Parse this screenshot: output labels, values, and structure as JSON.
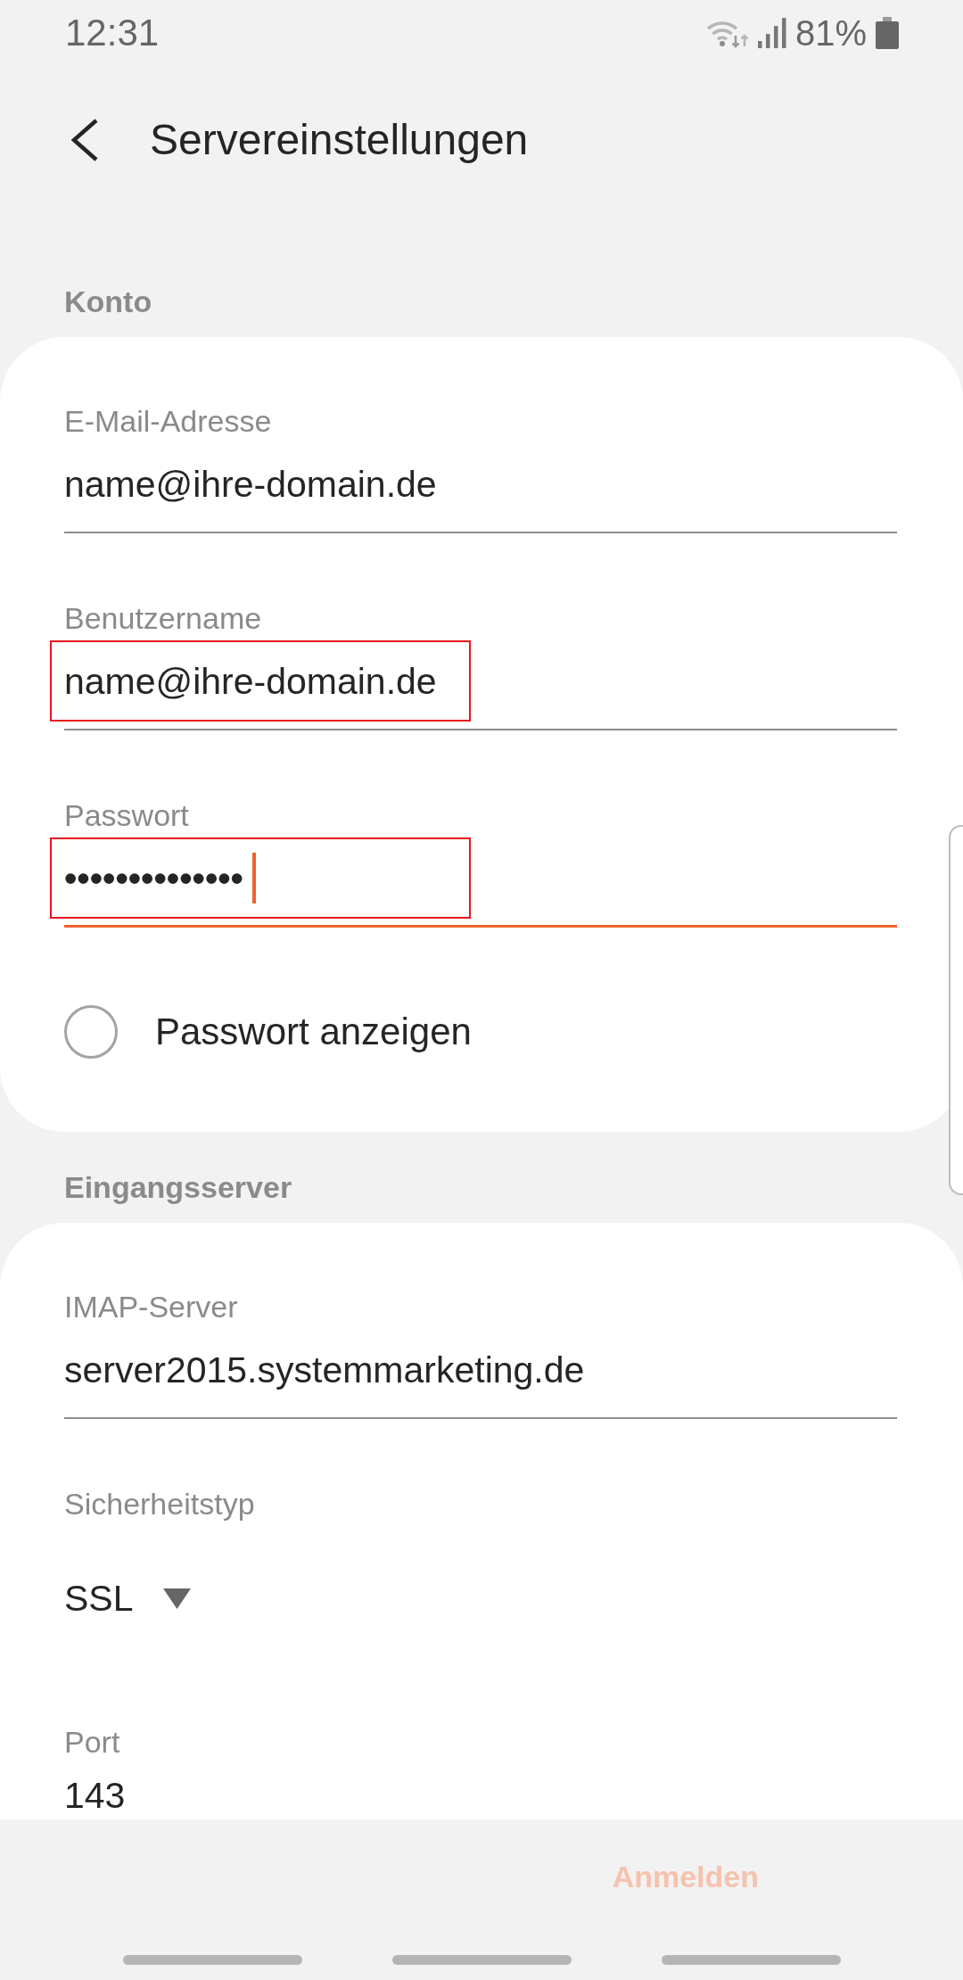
{
  "status_bar": {
    "time": "12:31",
    "battery": "81%"
  },
  "header": {
    "title": "Servereinstellungen"
  },
  "sections": [
    {
      "title": "Konto",
      "fields": [
        {
          "kind": "text",
          "label": "E-Mail-Adresse",
          "value": "name@ihre-domain.de",
          "focused": false,
          "highlighted": false
        },
        {
          "kind": "text",
          "label": "Benutzername",
          "value": "name@ihre-domain.de",
          "focused": false,
          "highlighted": true
        },
        {
          "kind": "password",
          "label": "Passwort",
          "value": "••••••••••••••",
          "focused": true,
          "highlighted": true
        },
        {
          "kind": "checkbox",
          "label": "Passwort anzeigen",
          "checked": false
        }
      ]
    },
    {
      "title": "Eingangsserver",
      "fields": [
        {
          "kind": "text",
          "label": "IMAP-Server",
          "value": "server2015.systemmarketing.de",
          "focused": false,
          "highlighted": false
        },
        {
          "kind": "dropdown",
          "label": "Sicherheitstyp",
          "value": "SSL"
        },
        {
          "kind": "text",
          "label": "Port",
          "value": "143",
          "focused": false,
          "highlighted": false
        }
      ]
    }
  ],
  "footer": {
    "button": {
      "label": "Anmelden",
      "disabled": true
    }
  }
}
